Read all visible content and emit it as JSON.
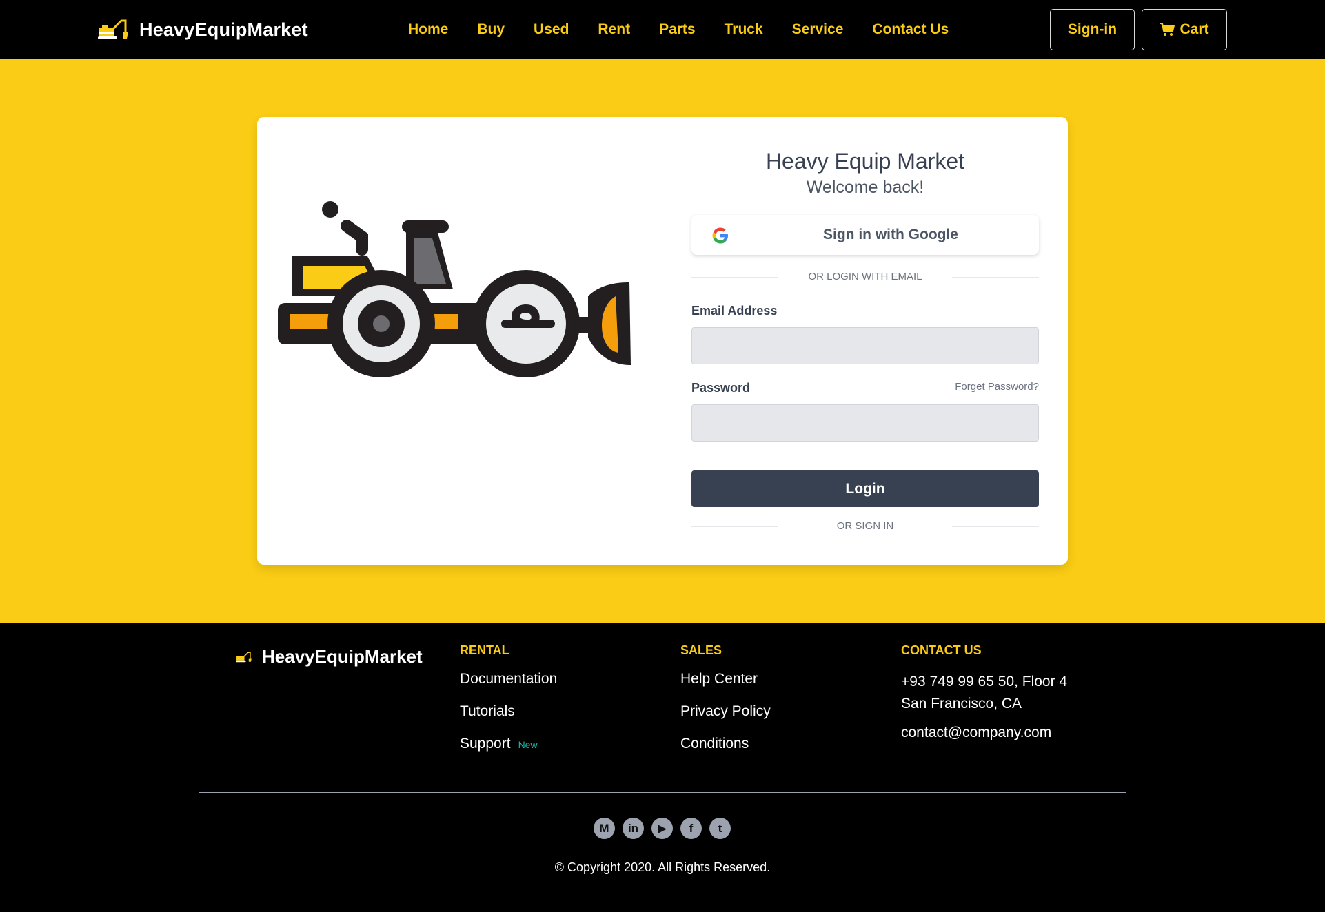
{
  "brand": {
    "name": "HeavyEquipMarket"
  },
  "nav": {
    "links": [
      "Home",
      "Buy",
      "Used",
      "Rent",
      "Parts",
      "Truck",
      "Service",
      "Contact Us"
    ],
    "signin_label": "Sign-in",
    "cart_label": "Cart"
  },
  "login": {
    "title": "Heavy Equip Market",
    "subtitle": "Welcome back!",
    "google_label": "Sign in with Google",
    "divider_email": "OR LOGIN WITH EMAIL",
    "email_label": "Email Address",
    "email_value": "",
    "password_label": "Password",
    "password_value": "",
    "forgot_label": "Forget Password?",
    "login_button": "Login",
    "divider_signin": "OR SIGN IN"
  },
  "footer": {
    "brand": "HeavyEquipMarket",
    "rental": {
      "heading": "RENTAL",
      "items": [
        "Documentation",
        "Tutorials",
        "Support"
      ],
      "support_badge": "New"
    },
    "sales": {
      "heading": "SALES",
      "items": [
        "Help Center",
        "Privacy Policy",
        "Conditions"
      ]
    },
    "contact": {
      "heading": "CONTACT US",
      "address_line1": "+93 749 99 65 50, Floor 4",
      "address_line2": "San Francisco, CA",
      "email": "contact@company.com"
    },
    "socials": [
      {
        "name": "medium-icon",
        "glyph": "M"
      },
      {
        "name": "linkedin-icon",
        "glyph": "in"
      },
      {
        "name": "youtube-icon",
        "glyph": "▶"
      },
      {
        "name": "facebook-icon",
        "glyph": "f"
      },
      {
        "name": "twitter-icon",
        "glyph": "t"
      }
    ],
    "copyright": "© Copyright 2020. All Rights Reserved."
  },
  "colors": {
    "accent": "#FACC15",
    "dark": "#374151",
    "nav_bg": "#000000",
    "badge": "#14B8A6"
  }
}
